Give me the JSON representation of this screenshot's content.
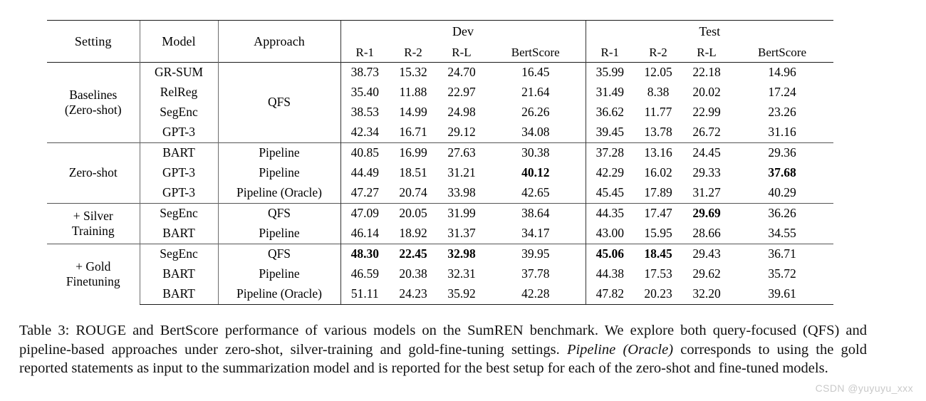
{
  "table": {
    "columns": {
      "setting": "Setting",
      "model": "Model",
      "approach": "Approach",
      "dev_group": "Dev",
      "test_group": "Test",
      "metrics": [
        "R-1",
        "R-2",
        "R-L",
        "BertScore"
      ]
    },
    "groups": [
      {
        "setting": "Baselines\n(Zero-shot)",
        "setting_line1": "Baselines",
        "setting_line2": "(Zero-shot)",
        "approach_spanned": "QFS",
        "rows": [
          {
            "model": "GR-SUM",
            "approach": "",
            "dev": [
              "38.73",
              "15.32",
              "24.70",
              "16.45"
            ],
            "test": [
              "35.99",
              "12.05",
              "22.18",
              "14.96"
            ],
            "dev_bold": [
              false,
              false,
              false,
              false
            ],
            "test_bold": [
              false,
              false,
              false,
              false
            ]
          },
          {
            "model": "RelReg",
            "approach": "",
            "dev": [
              "35.40",
              "11.88",
              "22.97",
              "21.64"
            ],
            "test": [
              "31.49",
              "8.38",
              "20.02",
              "17.24"
            ],
            "dev_bold": [
              false,
              false,
              false,
              false
            ],
            "test_bold": [
              false,
              false,
              false,
              false
            ]
          },
          {
            "model": "SegEnc",
            "approach": "",
            "dev": [
              "38.53",
              "14.99",
              "24.98",
              "26.26"
            ],
            "test": [
              "36.62",
              "11.77",
              "22.99",
              "23.26"
            ],
            "dev_bold": [
              false,
              false,
              false,
              false
            ],
            "test_bold": [
              false,
              false,
              false,
              false
            ]
          },
          {
            "model": "GPT-3",
            "approach": "",
            "dev": [
              "42.34",
              "16.71",
              "29.12",
              "34.08"
            ],
            "test": [
              "39.45",
              "13.78",
              "26.72",
              "31.16"
            ],
            "dev_bold": [
              false,
              false,
              false,
              false
            ],
            "test_bold": [
              false,
              false,
              false,
              false
            ]
          }
        ]
      },
      {
        "setting": "Zero-shot",
        "setting_line1": "Zero-shot",
        "setting_line2": "",
        "rows": [
          {
            "model": "BART",
            "approach": "Pipeline",
            "dev": [
              "40.85",
              "16.99",
              "27.63",
              "30.38"
            ],
            "test": [
              "37.28",
              "13.16",
              "24.45",
              "29.36"
            ],
            "dev_bold": [
              false,
              false,
              false,
              false
            ],
            "test_bold": [
              false,
              false,
              false,
              false
            ]
          },
          {
            "model": "GPT-3",
            "approach": "Pipeline",
            "dev": [
              "44.49",
              "18.51",
              "31.21",
              "40.12"
            ],
            "test": [
              "42.29",
              "16.02",
              "29.33",
              "37.68"
            ],
            "dev_bold": [
              false,
              false,
              false,
              true
            ],
            "test_bold": [
              false,
              false,
              false,
              true
            ]
          },
          {
            "model": "GPT-3",
            "approach": "Pipeline (Oracle)",
            "dev": [
              "47.27",
              "20.74",
              "33.98",
              "42.65"
            ],
            "test": [
              "45.45",
              "17.89",
              "31.27",
              "40.29"
            ],
            "dev_bold": [
              false,
              false,
              false,
              false
            ],
            "test_bold": [
              false,
              false,
              false,
              false
            ]
          }
        ]
      },
      {
        "setting": "+ Silver Training",
        "setting_line1": "+ Silver",
        "setting_line2": "Training",
        "rows": [
          {
            "model": "SegEnc",
            "approach": "QFS",
            "dev": [
              "47.09",
              "20.05",
              "31.99",
              "38.64"
            ],
            "test": [
              "44.35",
              "17.47",
              "29.69",
              "36.26"
            ],
            "dev_bold": [
              false,
              false,
              false,
              false
            ],
            "test_bold": [
              false,
              false,
              true,
              false
            ]
          },
          {
            "model": "BART",
            "approach": "Pipeline",
            "dev": [
              "46.14",
              "18.92",
              "31.37",
              "34.17"
            ],
            "test": [
              "43.00",
              "15.95",
              "28.66",
              "34.55"
            ],
            "dev_bold": [
              false,
              false,
              false,
              false
            ],
            "test_bold": [
              false,
              false,
              false,
              false
            ]
          }
        ]
      },
      {
        "setting": "+ Gold Finetuning",
        "setting_line1": "+ Gold",
        "setting_line2": "Finetuning",
        "rows": [
          {
            "model": "SegEnc",
            "approach": "QFS",
            "dev": [
              "48.30",
              "22.45",
              "32.98",
              "39.95"
            ],
            "test": [
              "45.06",
              "18.45",
              "29.43",
              "36.71"
            ],
            "dev_bold": [
              true,
              true,
              true,
              false
            ],
            "test_bold": [
              true,
              true,
              false,
              false
            ]
          },
          {
            "model": "BART",
            "approach": "Pipeline",
            "dev": [
              "46.59",
              "20.38",
              "32.31",
              "37.78"
            ],
            "test": [
              "44.38",
              "17.53",
              "29.62",
              "35.72"
            ],
            "dev_bold": [
              false,
              false,
              false,
              false
            ],
            "test_bold": [
              false,
              false,
              false,
              false
            ]
          },
          {
            "model": "BART",
            "approach": "Pipeline (Oracle)",
            "dev": [
              "51.11",
              "24.23",
              "35.92",
              "42.28"
            ],
            "test": [
              "47.82",
              "20.23",
              "32.20",
              "39.61"
            ],
            "dev_bold": [
              false,
              false,
              false,
              false
            ],
            "test_bold": [
              false,
              false,
              false,
              false
            ]
          }
        ]
      }
    ]
  },
  "caption": {
    "label": "Table 3:",
    "part1": " ROUGE and BertScore performance of various models on the SumREN benchmark. We explore both query-focused (QFS) and pipeline-based approaches under zero-shot, silver-training and gold-fine-tuning settings. ",
    "italic": "Pipeline (Oracle)",
    "part2": " corresponds to using the gold reported statements as input to the summarization model and is reported for the best setup for each of the zero-shot and fine-tuned models."
  },
  "watermark": {
    "text": "CSDN @yuyuyu_xxx"
  }
}
